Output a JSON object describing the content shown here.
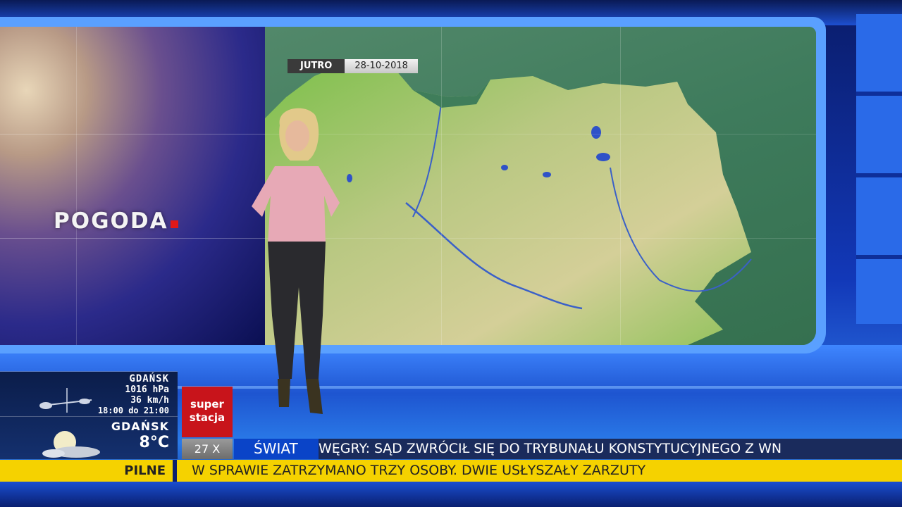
{
  "screen": {
    "title": "POGODA",
    "date_label": "JUTRO",
    "date_value": "28-10-2018"
  },
  "weather_box": {
    "city": "GDAŃSK",
    "pressure": "1016 hPa",
    "wind": "36 km/h",
    "time_range": "18:00 do 21:00",
    "city_current": "GDAŃSK",
    "temperature": "8°C",
    "icons": [
      "wind-icon",
      "partly-cloudy-night-icon"
    ]
  },
  "channel": {
    "logo_line1": "super",
    "logo_line2": "stacja",
    "date_chip": "27 X",
    "brand_color": "#c8141b"
  },
  "ticker": {
    "category": "ŚWIAT",
    "text": "WĘGRY: SĄD  ZWRÓCIŁ SIĘ DO TRYBUNAŁU KONSTYTUCYJNEGO Z WN"
  },
  "breaking": {
    "label": "PILNE",
    "text": "W SPRAWIE ZATRZYMANO TRZY OSOBY. DWIE USŁYSZAŁY ZARZUTY",
    "color": "#f5d200"
  }
}
